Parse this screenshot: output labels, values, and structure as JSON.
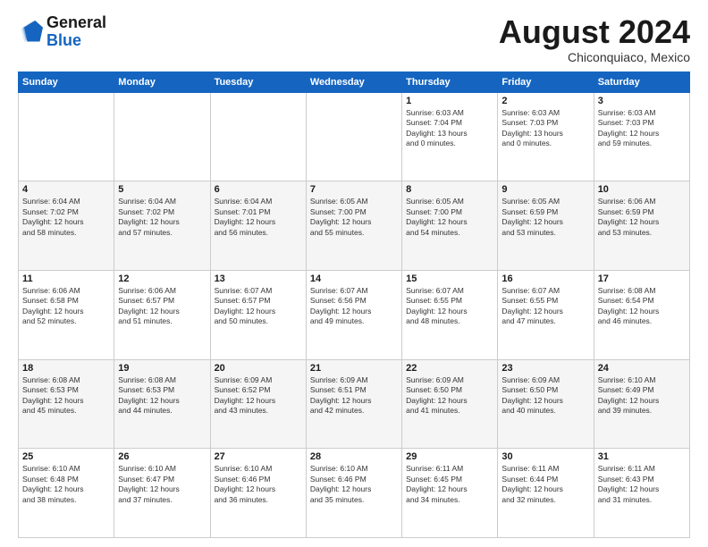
{
  "header": {
    "logo_line1": "General",
    "logo_line2": "Blue",
    "month": "August 2024",
    "location": "Chiconquiaco, Mexico"
  },
  "weekdays": [
    "Sunday",
    "Monday",
    "Tuesday",
    "Wednesday",
    "Thursday",
    "Friday",
    "Saturday"
  ],
  "weeks": [
    [
      {
        "day": "",
        "info": ""
      },
      {
        "day": "",
        "info": ""
      },
      {
        "day": "",
        "info": ""
      },
      {
        "day": "",
        "info": ""
      },
      {
        "day": "1",
        "info": "Sunrise: 6:03 AM\nSunset: 7:04 PM\nDaylight: 13 hours\nand 0 minutes."
      },
      {
        "day": "2",
        "info": "Sunrise: 6:03 AM\nSunset: 7:03 PM\nDaylight: 13 hours\nand 0 minutes."
      },
      {
        "day": "3",
        "info": "Sunrise: 6:03 AM\nSunset: 7:03 PM\nDaylight: 12 hours\nand 59 minutes."
      }
    ],
    [
      {
        "day": "4",
        "info": "Sunrise: 6:04 AM\nSunset: 7:02 PM\nDaylight: 12 hours\nand 58 minutes."
      },
      {
        "day": "5",
        "info": "Sunrise: 6:04 AM\nSunset: 7:02 PM\nDaylight: 12 hours\nand 57 minutes."
      },
      {
        "day": "6",
        "info": "Sunrise: 6:04 AM\nSunset: 7:01 PM\nDaylight: 12 hours\nand 56 minutes."
      },
      {
        "day": "7",
        "info": "Sunrise: 6:05 AM\nSunset: 7:00 PM\nDaylight: 12 hours\nand 55 minutes."
      },
      {
        "day": "8",
        "info": "Sunrise: 6:05 AM\nSunset: 7:00 PM\nDaylight: 12 hours\nand 54 minutes."
      },
      {
        "day": "9",
        "info": "Sunrise: 6:05 AM\nSunset: 6:59 PM\nDaylight: 12 hours\nand 53 minutes."
      },
      {
        "day": "10",
        "info": "Sunrise: 6:06 AM\nSunset: 6:59 PM\nDaylight: 12 hours\nand 53 minutes."
      }
    ],
    [
      {
        "day": "11",
        "info": "Sunrise: 6:06 AM\nSunset: 6:58 PM\nDaylight: 12 hours\nand 52 minutes."
      },
      {
        "day": "12",
        "info": "Sunrise: 6:06 AM\nSunset: 6:57 PM\nDaylight: 12 hours\nand 51 minutes."
      },
      {
        "day": "13",
        "info": "Sunrise: 6:07 AM\nSunset: 6:57 PM\nDaylight: 12 hours\nand 50 minutes."
      },
      {
        "day": "14",
        "info": "Sunrise: 6:07 AM\nSunset: 6:56 PM\nDaylight: 12 hours\nand 49 minutes."
      },
      {
        "day": "15",
        "info": "Sunrise: 6:07 AM\nSunset: 6:55 PM\nDaylight: 12 hours\nand 48 minutes."
      },
      {
        "day": "16",
        "info": "Sunrise: 6:07 AM\nSunset: 6:55 PM\nDaylight: 12 hours\nand 47 minutes."
      },
      {
        "day": "17",
        "info": "Sunrise: 6:08 AM\nSunset: 6:54 PM\nDaylight: 12 hours\nand 46 minutes."
      }
    ],
    [
      {
        "day": "18",
        "info": "Sunrise: 6:08 AM\nSunset: 6:53 PM\nDaylight: 12 hours\nand 45 minutes."
      },
      {
        "day": "19",
        "info": "Sunrise: 6:08 AM\nSunset: 6:53 PM\nDaylight: 12 hours\nand 44 minutes."
      },
      {
        "day": "20",
        "info": "Sunrise: 6:09 AM\nSunset: 6:52 PM\nDaylight: 12 hours\nand 43 minutes."
      },
      {
        "day": "21",
        "info": "Sunrise: 6:09 AM\nSunset: 6:51 PM\nDaylight: 12 hours\nand 42 minutes."
      },
      {
        "day": "22",
        "info": "Sunrise: 6:09 AM\nSunset: 6:50 PM\nDaylight: 12 hours\nand 41 minutes."
      },
      {
        "day": "23",
        "info": "Sunrise: 6:09 AM\nSunset: 6:50 PM\nDaylight: 12 hours\nand 40 minutes."
      },
      {
        "day": "24",
        "info": "Sunrise: 6:10 AM\nSunset: 6:49 PM\nDaylight: 12 hours\nand 39 minutes."
      }
    ],
    [
      {
        "day": "25",
        "info": "Sunrise: 6:10 AM\nSunset: 6:48 PM\nDaylight: 12 hours\nand 38 minutes."
      },
      {
        "day": "26",
        "info": "Sunrise: 6:10 AM\nSunset: 6:47 PM\nDaylight: 12 hours\nand 37 minutes."
      },
      {
        "day": "27",
        "info": "Sunrise: 6:10 AM\nSunset: 6:46 PM\nDaylight: 12 hours\nand 36 minutes."
      },
      {
        "day": "28",
        "info": "Sunrise: 6:10 AM\nSunset: 6:46 PM\nDaylight: 12 hours\nand 35 minutes."
      },
      {
        "day": "29",
        "info": "Sunrise: 6:11 AM\nSunset: 6:45 PM\nDaylight: 12 hours\nand 34 minutes."
      },
      {
        "day": "30",
        "info": "Sunrise: 6:11 AM\nSunset: 6:44 PM\nDaylight: 12 hours\nand 32 minutes."
      },
      {
        "day": "31",
        "info": "Sunrise: 6:11 AM\nSunset: 6:43 PM\nDaylight: 12 hours\nand 31 minutes."
      }
    ]
  ]
}
